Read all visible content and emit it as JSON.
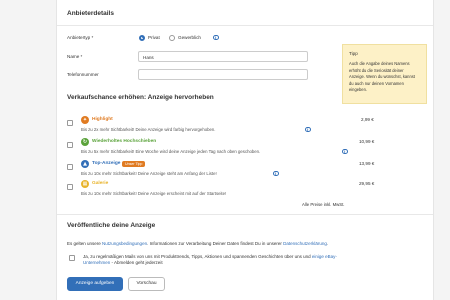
{
  "details": {
    "title": "Anbieterdetails",
    "type_label": "Anbietertyp *",
    "type_options": [
      "Privat",
      "Gewerblich"
    ],
    "name_label": "Name *",
    "name_value": "Hans",
    "phone_label": "Telefonnummer",
    "phone_value": ""
  },
  "tip": {
    "title": "Tipp",
    "text": "Auch die Angabe deines Namens erhöht du die Seriosität deiner Anzeige. Wenn du wünschst, kannst du auch nur deinen Vornamen eingeben."
  },
  "promo": {
    "title": "Verkaufschance erhöhen: Anzeige hervorheben",
    "options": [
      {
        "name": "Highlight",
        "desc": "Bis zu 2x mehr Sichtbarkeit! Deine Anzeige wird farbig hervorgehoben.",
        "price": "2,99 €",
        "color": "#e07b22",
        "icon": "highlight-icon"
      },
      {
        "name": "Wiederholtes Hochschieben",
        "desc": "Bis zu 5x mehr Sichtbarkeit! Eine Woche wird deine Anzeige jeden Tag nach oben geschoben.",
        "price": "10,99 €",
        "color": "#5ba33b",
        "icon": "repeat-icon"
      },
      {
        "name": "Top-Anzeige",
        "desc": "Bis zu 10x mehr Sichtbarkeit! Deine Anzeige steht am Anfang der Liste!",
        "price": "13,99 €",
        "color": "#326fb8",
        "icon": "top-ad-icon",
        "badge": "Unser Tipp"
      },
      {
        "name": "Galerie",
        "desc": "Bis zu 10x mehr Sichtbarkeit! Deine Anzeige erscheint mit auf der Startseite!",
        "price": "29,95 €",
        "color": "#e8b32a",
        "icon": "gallery-icon"
      }
    ],
    "note": "Alle Preise inkl. MwSt."
  },
  "publish": {
    "title": "Veröffentliche deine Anzeige",
    "text_before": "Es gelten unsere ",
    "terms_link": "Nutzungsbedingungen",
    "text_middle": ". Informationen zur Verarbeitung Deiner Daten findest Du in unserer ",
    "privacy_link": "Datenschutzerklärung",
    "text_after": ".",
    "consent_text": "Ja, zu regelmäßigen Mails von uns mit Produkttrends, Tipps, Aktionen und spannenden Geschichten über uns und ",
    "consent_link": "einige eBay-Unternehmen",
    "consent_after": " - Abmelden geht jederzeit",
    "submit_label": "Anzeige aufgeben",
    "preview_label": "Vorschau"
  }
}
